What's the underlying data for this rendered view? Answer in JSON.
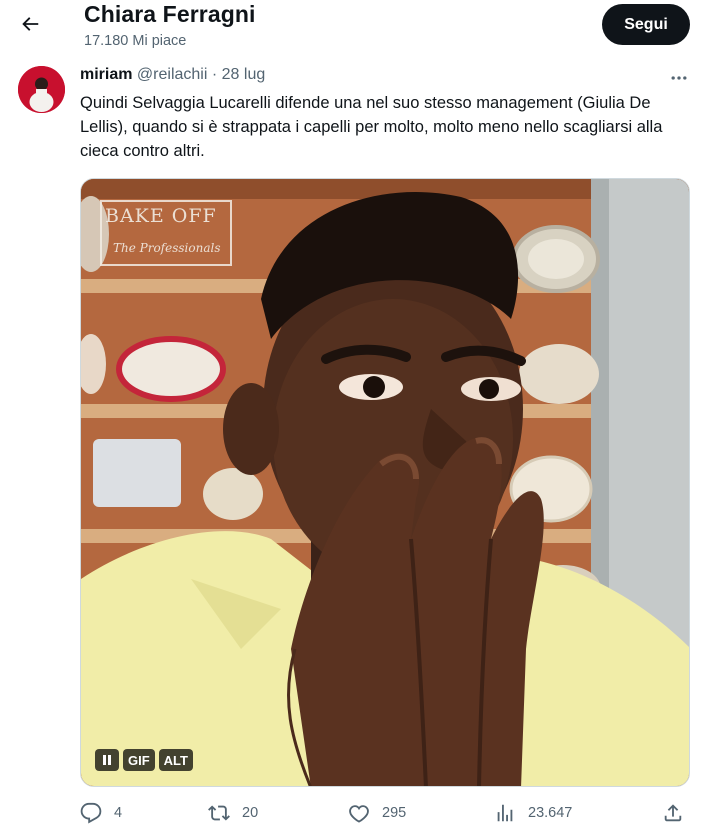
{
  "header": {
    "title": "Chiara Ferragni",
    "likes_label": "17.180 Mi piace",
    "follow_label": "Segui",
    "back_icon": "arrow-left-icon"
  },
  "tweet": {
    "author": "miriam",
    "handle": "@reilachii",
    "separator": "·",
    "date": "28 lug",
    "text": "Quindi Selvaggia Lucarelli difende una nel suo stesso management (Giulia De Lellis), quando si è  strappata i capelli per molto, molto meno nello scagliarsi alla cieca contro altri.",
    "media": {
      "watermark_line1": "BAKE OFF",
      "watermark_line2": "The Professionals",
      "gif_label": "GIF",
      "alt_label": "ALT",
      "pause_icon": "pause-icon"
    },
    "actions": {
      "replies": "4",
      "retweets": "20",
      "likes": "295",
      "views": "23.647"
    }
  },
  "colors": {
    "text_primary": "#0f1419",
    "text_secondary": "#536471",
    "follow_bg": "#0f1419",
    "border": "#cfd9de"
  }
}
